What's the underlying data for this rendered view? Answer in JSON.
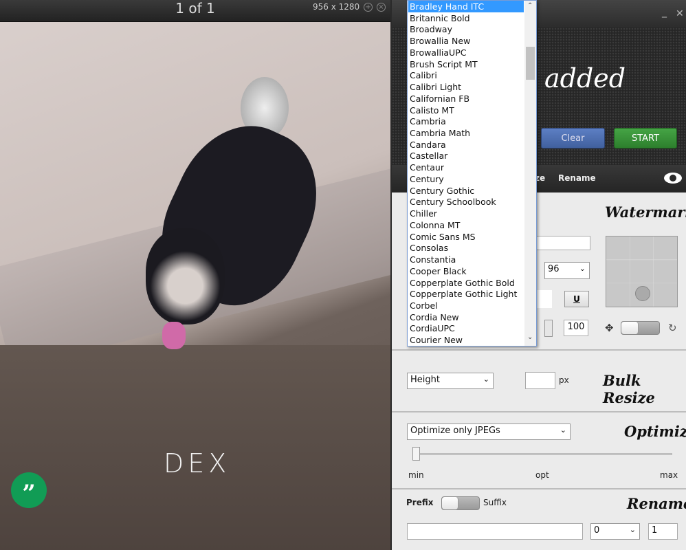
{
  "viewer": {
    "counter": "1 of 1",
    "dimensions": "956 x 1280",
    "zoom_in_icon": "+",
    "close_icon": "×",
    "photo_caption": "DEX",
    "hangouts_icon": "quote-icon"
  },
  "app": {
    "hero_title": "added",
    "clear_label": "Clear",
    "start_label": "START",
    "minimize": "_",
    "close": "✕",
    "nav": {
      "partial_item": "ze",
      "rename": "Rename"
    },
    "watermark": {
      "title": "Watermark",
      "font_size": "96",
      "underline": "U",
      "opacity": "100"
    },
    "bulk_resize": {
      "title": "Bulk Resize",
      "dimension": "Height",
      "value": "",
      "unit": "px"
    },
    "optimize": {
      "title": "Optimize",
      "mode": "Optimize only JPEGs",
      "min": "min",
      "opt": "opt",
      "max": "max",
      "level": 0
    },
    "rename": {
      "title": "Rename",
      "prefix": "Prefix",
      "suffix": "Suffix",
      "text": "",
      "pad": "0",
      "start": "1"
    }
  },
  "font_dropdown": {
    "selected": "Bradley Hand ITC",
    "options": [
      "Bradley Hand ITC",
      "Britannic Bold",
      "Broadway",
      "Browallia New",
      "BrowalliaUPC",
      "Brush Script MT",
      "Calibri",
      "Calibri Light",
      "Californian FB",
      "Calisto MT",
      "Cambria",
      "Cambria Math",
      "Candara",
      "Castellar",
      "Centaur",
      "Century",
      "Century Gothic",
      "Century Schoolbook",
      "Chiller",
      "Colonna MT",
      "Comic Sans MS",
      "Consolas",
      "Constantia",
      "Cooper Black",
      "Copperplate Gothic Bold",
      "Copperplate Gothic Light",
      "Corbel",
      "Cordia New",
      "CordiaUPC",
      "Courier New"
    ]
  },
  "colors": {
    "selection": "#3399ff",
    "start": "#3a953a",
    "clear": "#4f70b3"
  }
}
